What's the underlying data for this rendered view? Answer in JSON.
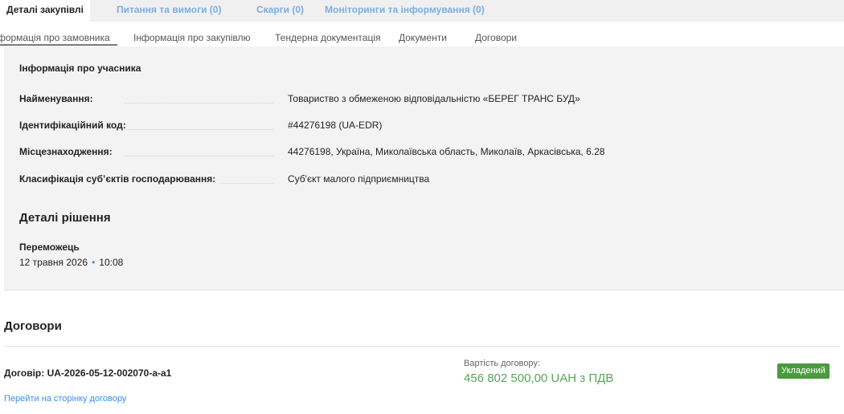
{
  "top_tabs": [
    {
      "label": "Деталі закупівлі",
      "active": true
    },
    {
      "label": "Питання та вимоги (0)",
      "active": false
    },
    {
      "label": "Скарги (0)",
      "active": false
    },
    {
      "label": "Моніторинги та інформування (0)",
      "active": false
    }
  ],
  "sub_tabs": [
    {
      "label": "Інформація про замовника"
    },
    {
      "label": "Інформація про закупівлю"
    },
    {
      "label": "Тендерна документація"
    },
    {
      "label": "Документи"
    },
    {
      "label": "Договори"
    }
  ],
  "participant": {
    "title": "Інформація про учасника",
    "rows": [
      {
        "label": "Найменування:",
        "value": "Товариство з обмеженою відповідальністю «БЕРЕГ ТРАНС БУД»"
      },
      {
        "label": "Ідентифікаційний код:",
        "value": "#44276198 (UA-EDR)"
      },
      {
        "label": "Місцезнаходження:",
        "value": "44276198, Україна, Миколаївська область, Миколаїв, Аркасівська, 6.28"
      },
      {
        "label": "Класифікація суб’єктів господарювання:",
        "value": "Суб'єкт малого підприємництва"
      }
    ]
  },
  "decision": {
    "title": "Деталі рішення",
    "winner_label": "Переможець",
    "date": "12 травня 2026",
    "separator": "•",
    "time": "10:08"
  },
  "contracts": {
    "title": "Договори",
    "contract_id": "Договір: UA-2026-05-12-002070-a-a1",
    "link": "Перейти на сторінку договору",
    "value_label": "Вартість договору:",
    "value_amount": "456 802 500,00 UAH з ПДВ",
    "status": "Укладений",
    "status_color": "#4a9a3f"
  }
}
